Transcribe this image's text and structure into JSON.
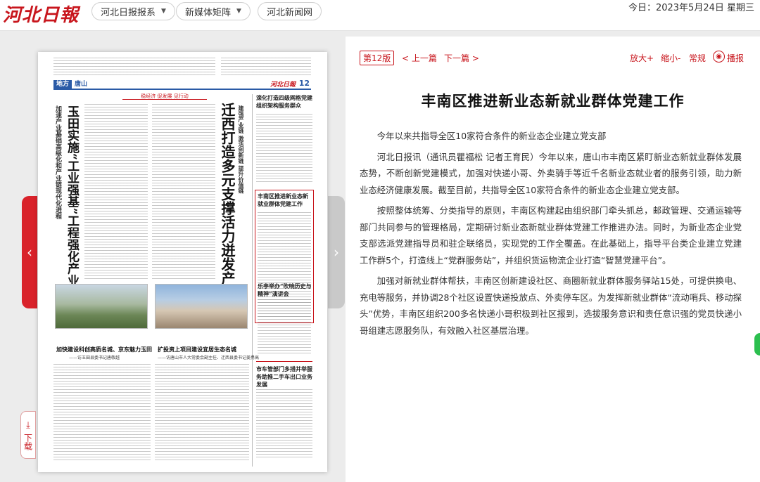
{
  "header": {
    "logo_text": "河北日報",
    "nav": [
      {
        "label": "河北日报报系",
        "has_dropdown": true
      },
      {
        "label": "新媒体矩阵",
        "has_dropdown": true
      },
      {
        "label": "河北新闻网",
        "has_dropdown": false
      }
    ],
    "date_text": "今日：2023年5月24日 星期三"
  },
  "pager": {
    "prev_glyph": "‹",
    "next_glyph": "›",
    "download_label": "下载"
  },
  "newspaper": {
    "section": "地方",
    "section_city": "唐山",
    "masthead": "河北日報",
    "page_no": "12",
    "banner": "稳经济 促发展 见行动",
    "headline_a": "玉田实施“工业强基”工程强化产业支撑",
    "subhead_a": "加速产业基础高级化和产业链现代化进程",
    "headline_b": "迁西打造多元支撑活力迸发产业格局",
    "subhead_b": "建强产业链 激活创新链 提升价值链",
    "side_title_1": "滦化打造四级网格党建组织架构服务群众",
    "side_title_2": "丰南区推进新业态新就业群体党建工作",
    "side_title_3": "乐亭举办“吹响历史与精神”演讲会",
    "side_title_4": "市车管部门多措并举服务助推二手车出口业务发展",
    "caption_1": "加快建设科创高质名城、京东魅力玉田",
    "caption_1_sub": "——访玉田县委书记唐敬越",
    "caption_2": "扩投资上项目建设宜居生态名城",
    "caption_2_sub": "——访唐山市人大常委会副主任、迁西县委书记姜勇高"
  },
  "article": {
    "edition": "第12版",
    "prev": "< 上一篇",
    "next": "下一篇 >",
    "zoom_in": "放大+",
    "zoom_out": "缩小-",
    "normal": "常规",
    "broadcast": "播报",
    "title": "丰南区推进新业态新就业群体党建工作",
    "paragraphs": [
      "今年以来共指导全区10家符合条件的新业态企业建立党支部",
      "河北日报讯（通讯员瞿福松 记者王育民）今年以来，唐山市丰南区紧盯新业态新就业群体发展态势，不断创新党建模式，加强对快递小哥、外卖骑手等近千名新业态就业者的服务引领，助力新业态经济健康发展。截至目前，共指导全区10家符合条件的新业态企业建立党支部。",
      "按照整体统筹、分类指导的原则，丰南区构建起由组织部门牵头抓总，邮政管理、交通运输等部门共同参与的管理格局，定期研讨新业态新就业群体党建工作推进办法。同时，为新业态企业党支部选派党建指导员和驻企联络员，实现党的工作全覆盖。在此基础上，指导平台类企业建立党建工作群5个，打造线上“党群服务站”，并组织货运物流企业打造“智慧党建平台”。",
      "加强对新就业群体帮扶，丰南区创新建设社区、商圈新就业群体服务驿站15处，可提供换电、充电等服务，并协调28个社区设置快递投放点、外卖停车区。为发挥新就业群体“流动哨兵、移动探头”优势，丰南区组织200多名快递小哥积极到社区报到，选拔服务意识和责任意识强的党员快递小哥组建志愿服务队，有效融入社区基层治理。"
    ]
  },
  "icons": {
    "caret": "▼",
    "play": "◉",
    "download": "⤓"
  }
}
